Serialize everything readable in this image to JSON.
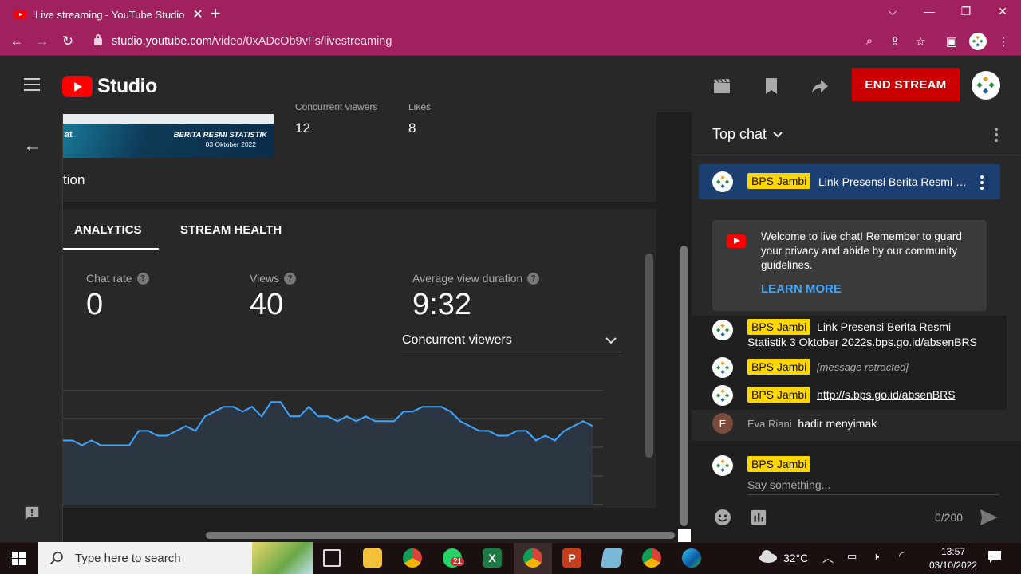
{
  "browser": {
    "tab_title": "Live streaming - YouTube Studio",
    "url_host": "studio.youtube.com",
    "url_path": "/video/0xADcOb9vFs/livestreaming"
  },
  "studio": {
    "logo_text": "Studio",
    "end_stream_label": "END STREAM"
  },
  "stream": {
    "thumbnail_title": "BERITA RESMI STATISTIK",
    "thumbnail_date": "03 Oktober 2022",
    "thumbnail_left": "at",
    "concurrent_label_cut": "Concurrent viewers",
    "concurrent_value": "12",
    "likes_label_cut": "Likes",
    "likes_value": "8",
    "description_cut": "tion"
  },
  "tabs": [
    {
      "label": "ANALYTICS",
      "active": true
    },
    {
      "label": "STREAM HEALTH",
      "active": false
    }
  ],
  "metrics": [
    {
      "label": "Chat rate",
      "value": "0"
    },
    {
      "label": "Views",
      "value": "40"
    },
    {
      "label": "Average view duration",
      "value": "9:32"
    }
  ],
  "chart_selector": "Concurrent viewers",
  "chart_data": {
    "type": "area",
    "title": "",
    "x": [
      0,
      1,
      2,
      3,
      4,
      5,
      6,
      7,
      8,
      9,
      10,
      11,
      12,
      13,
      14,
      15,
      16,
      17,
      18,
      19,
      20,
      21,
      22,
      23,
      24,
      25,
      26,
      27,
      28,
      29,
      30,
      31,
      32,
      33,
      34,
      35,
      36,
      37,
      38,
      39,
      40,
      41,
      42,
      43,
      44,
      45,
      46,
      47,
      48,
      49,
      50,
      51,
      52,
      53,
      54,
      55,
      56
    ],
    "values": [
      10,
      10,
      9.5,
      10,
      9.5,
      9.5,
      9.5,
      9.5,
      11,
      11,
      10.5,
      10.5,
      11,
      11.5,
      11,
      12.5,
      13,
      13.5,
      13.5,
      13,
      13.5,
      12.5,
      14,
      14,
      12.5,
      12.5,
      13.5,
      12.5,
      12.5,
      12,
      12.5,
      12,
      12.5,
      12,
      12,
      12,
      13,
      13,
      13.5,
      13.5,
      13.5,
      13,
      12,
      11.5,
      11,
      11,
      10.5,
      10.5,
      11,
      11,
      10,
      10.5,
      10,
      11,
      11.5,
      12,
      11.5
    ],
    "ylim": [
      4,
      16
    ],
    "color": "#3ea6ff"
  },
  "chat": {
    "title": "Top chat",
    "pinned": {
      "author": "BPS Jambi",
      "text": "Link Presensi Berita Resmi …"
    },
    "welcome_text": "Welcome to live chat! Remember to guard your privacy and abide by our community guidelines.",
    "learn_more": "LEARN MORE",
    "messages": [
      {
        "author": "BPS Jambi",
        "text": "Link Presensi Berita Resmi Statistik 3 Oktober 2022s.bps.go.id/absenBRS"
      },
      {
        "author": "BPS Jambi",
        "text": "[message retracted]"
      },
      {
        "author": "BPS Jambi",
        "text": "http://s.bps.go.id/absenBRS"
      },
      {
        "author": "Eva Riani",
        "text": "hadir menyimak",
        "initial": "E"
      }
    ],
    "composer_author": "BPS Jambi",
    "input_placeholder": "Say something...",
    "counter": "0/200"
  },
  "taskbar": {
    "search_placeholder": "Type here to search",
    "weather": "32°C",
    "time": "13:57",
    "date": "03/10/2022",
    "whatsapp_badge": "21"
  }
}
